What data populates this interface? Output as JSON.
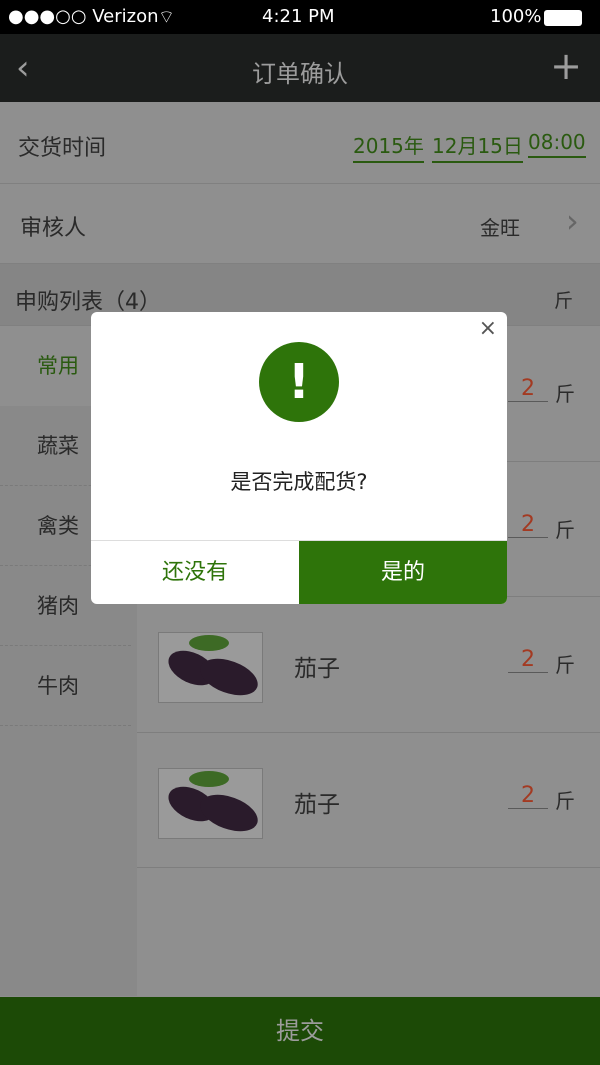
{
  "status_bar": {
    "carrier": "●●●○○ Verizon",
    "time": "4:21 PM",
    "battery": "100%"
  },
  "nav": {
    "title": "订单确认",
    "back_icon": "chevron-left-icon",
    "add_icon": "plus-icon"
  },
  "delivery": {
    "label": "交货时间",
    "year": "2015年",
    "date": "12月15日",
    "time": "08:00"
  },
  "reviewer": {
    "label": "审核人",
    "value": "金旺"
  },
  "list_header": {
    "label": "申购列表（4）",
    "unit": "斤"
  },
  "sidebar": {
    "items": [
      {
        "label": "常用"
      },
      {
        "label": "蔬菜"
      },
      {
        "label": "禽类"
      },
      {
        "label": "猪肉"
      },
      {
        "label": "牛肉"
      }
    ]
  },
  "items": [
    {
      "name": "",
      "qty": "2",
      "unit": "斤"
    },
    {
      "name": "",
      "qty": "2",
      "unit": "斤"
    },
    {
      "name": "茄子",
      "qty": "2",
      "unit": "斤"
    },
    {
      "name": "茄子",
      "qty": "2",
      "unit": "斤"
    }
  ],
  "submit_label": "提交",
  "dialog": {
    "message": "是否完成配货?",
    "cancel": "还没有",
    "confirm": "是的",
    "icon": "exclamation-icon",
    "close": "×",
    "accent": "#2e740a"
  }
}
